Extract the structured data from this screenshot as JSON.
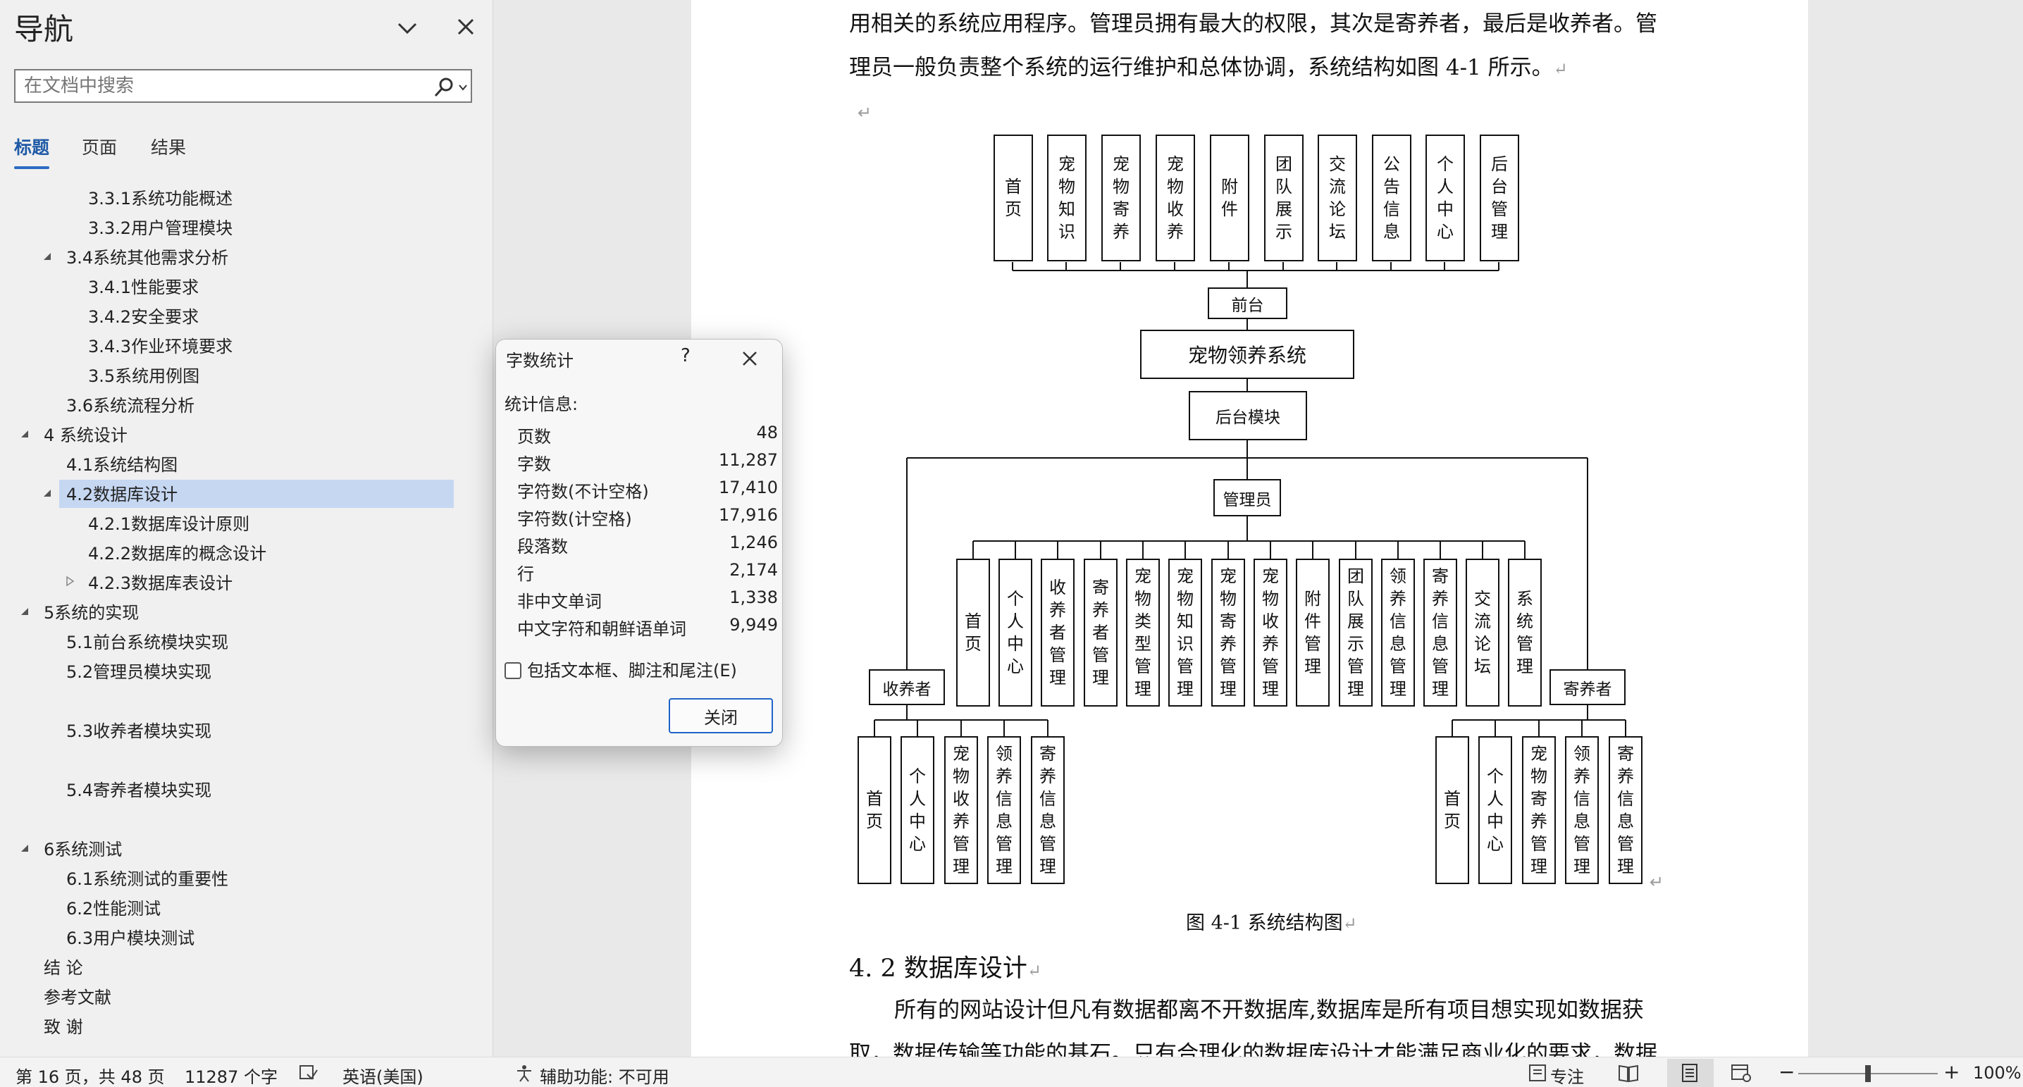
{
  "nav": {
    "title": "导航",
    "search_placeholder": "在文档中搜索",
    "tabs": [
      {
        "label": "标题"
      },
      {
        "label": "页面"
      },
      {
        "label": "结果"
      }
    ],
    "toc": [
      {
        "label": "3.3.1系统功能概述"
      },
      {
        "label": "3.3.2用户管理模块"
      },
      {
        "label": "3.4系统其他需求分析"
      },
      {
        "label": "3.4.1性能要求"
      },
      {
        "label": "3.4.2安全要求"
      },
      {
        "label": "3.4.3作业环境要求"
      },
      {
        "label": "3.5系统用例图"
      },
      {
        "label": "3.6系统流程分析"
      },
      {
        "label": "4 系统设计"
      },
      {
        "label": "4.1系统结构图"
      },
      {
        "label": "4.2数据库设计"
      },
      {
        "label": "4.2.1数据库设计原则"
      },
      {
        "label": "4.2.2数据库的概念设计"
      },
      {
        "label": "4.2.3数据库表设计"
      },
      {
        "label": "5系统的实现"
      },
      {
        "label": "5.1前台系统模块实现"
      },
      {
        "label": "5.2管理员模块实现"
      },
      {
        "label": "5.3收养者模块实现"
      },
      {
        "label": "5.4寄养者模块实现"
      },
      {
        "label": "6系统测试"
      },
      {
        "label": "6.1系统测试的重要性"
      },
      {
        "label": "6.2性能测试"
      },
      {
        "label": "6.3用户模块测试"
      },
      {
        "label": "结 论"
      },
      {
        "label": "参考文献"
      },
      {
        "label": "致 谢"
      }
    ]
  },
  "document": {
    "para1_line1": "用相关的系统应用程序。管理员拥有最大的权限，其次是寄养者，最后是收养者。管",
    "para1_line2": "理员一般负责整个系统的运行维护和总体协调，系统结构如图 4-1 所示。",
    "para_mark": "↵",
    "figure_caption": "图 4-1 系统结构图",
    "heading": "4. 2 数据库设计",
    "para2_line1": "所有的网站设计但凡有数据都离不开数据库,数据库是所有项目想实现如数据获",
    "para2_line2": "取，数据传输等功能的基石。只有合理化的数据库设计才能满足商业化的要求，数据",
    "diagram": {
      "front_modules": [
        "首页",
        "宠物知识",
        "宠物寄养",
        "宠物收养",
        "附件",
        "团队展示",
        "交流论坛",
        "公告信息",
        "个人中心",
        "后台管理"
      ],
      "front_label": "前台",
      "system_label": "宠物领养系统",
      "backend_label": "后台模块",
      "admin_label": "管理员",
      "admin_modules": [
        "首页",
        "个人中心",
        "收养者管理",
        "寄养者管理",
        "宠物类型管理",
        "宠物知识管理",
        "宠物寄养管理",
        "宠物收养管理",
        "附件管理",
        "团队展示管理",
        "领养信息管理",
        "寄养信息管理",
        "交流论坛",
        "系统管理"
      ],
      "adopter_label": "收养者",
      "adopter_modules": [
        "首页",
        "个人中心",
        "宠物收养管理",
        "领养信息管理",
        "寄养信息管理"
      ],
      "fosterer_label": "寄养者",
      "fosterer_modules": [
        "首页",
        "个人中心",
        "宠物寄养管理",
        "领养信息管理",
        "寄养信息管理"
      ]
    }
  },
  "dialog": {
    "title": "字数统计",
    "help": "?",
    "section_label": "统计信息:",
    "stats": [
      {
        "label": "页数",
        "value": "48"
      },
      {
        "label": "字数",
        "value": "11,287"
      },
      {
        "label": "字符数(不计空格)",
        "value": "17,410"
      },
      {
        "label": "字符数(计空格)",
        "value": "17,916"
      },
      {
        "label": "段落数",
        "value": "1,246"
      },
      {
        "label": "行",
        "value": "2,174"
      },
      {
        "label": "非中文单词",
        "value": "1,338"
      },
      {
        "label": "中文字符和朝鲜语单词",
        "value": "9,949"
      }
    ],
    "checkbox_label": "包括文本框、脚注和尾注(E)",
    "checkbox_checked": false,
    "close_label": "关闭"
  },
  "status": {
    "page": "第 16 页，共 48 页",
    "words": "11287 个字",
    "language": "英语(美国)",
    "accessibility": "辅助功能: 不可用",
    "focus": "专注",
    "zoom": "100%",
    "zoom_level": 1.0
  }
}
